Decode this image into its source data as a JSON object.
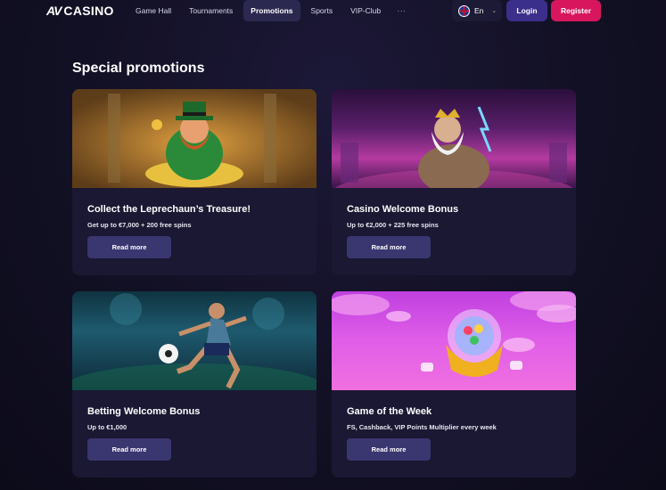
{
  "header": {
    "logo_mark": "AV",
    "logo_text": "CASINO",
    "nav": [
      "Game Hall",
      "Tournaments",
      "Promotions",
      "Sports",
      "VIP-Club"
    ],
    "nav_more": "···",
    "language": "En",
    "login": "Login",
    "register": "Register",
    "active_nav": "Promotions"
  },
  "page": {
    "title": "Special promotions"
  },
  "promotions": [
    {
      "title": "Collect the Leprechaun’s Treasure!",
      "subtitle": "Get up to €7,000 + 200 free spins",
      "button": "Read more"
    },
    {
      "title": "Casino Welcome Bonus",
      "subtitle": "Up to €2,000 + 225 free spins",
      "button": "Read more"
    },
    {
      "title": "Betting Welcome Bonus",
      "subtitle": "Up to €1,000",
      "button": "Read more"
    },
    {
      "title": "Game of the Week",
      "subtitle": "FS, Cashback, VIP Points Multiplier every week",
      "button": "Read more"
    }
  ],
  "colors": {
    "accent": "#d8165d",
    "login": "#3b2f8c",
    "card": "#1a1832",
    "button": "#3a3670"
  }
}
